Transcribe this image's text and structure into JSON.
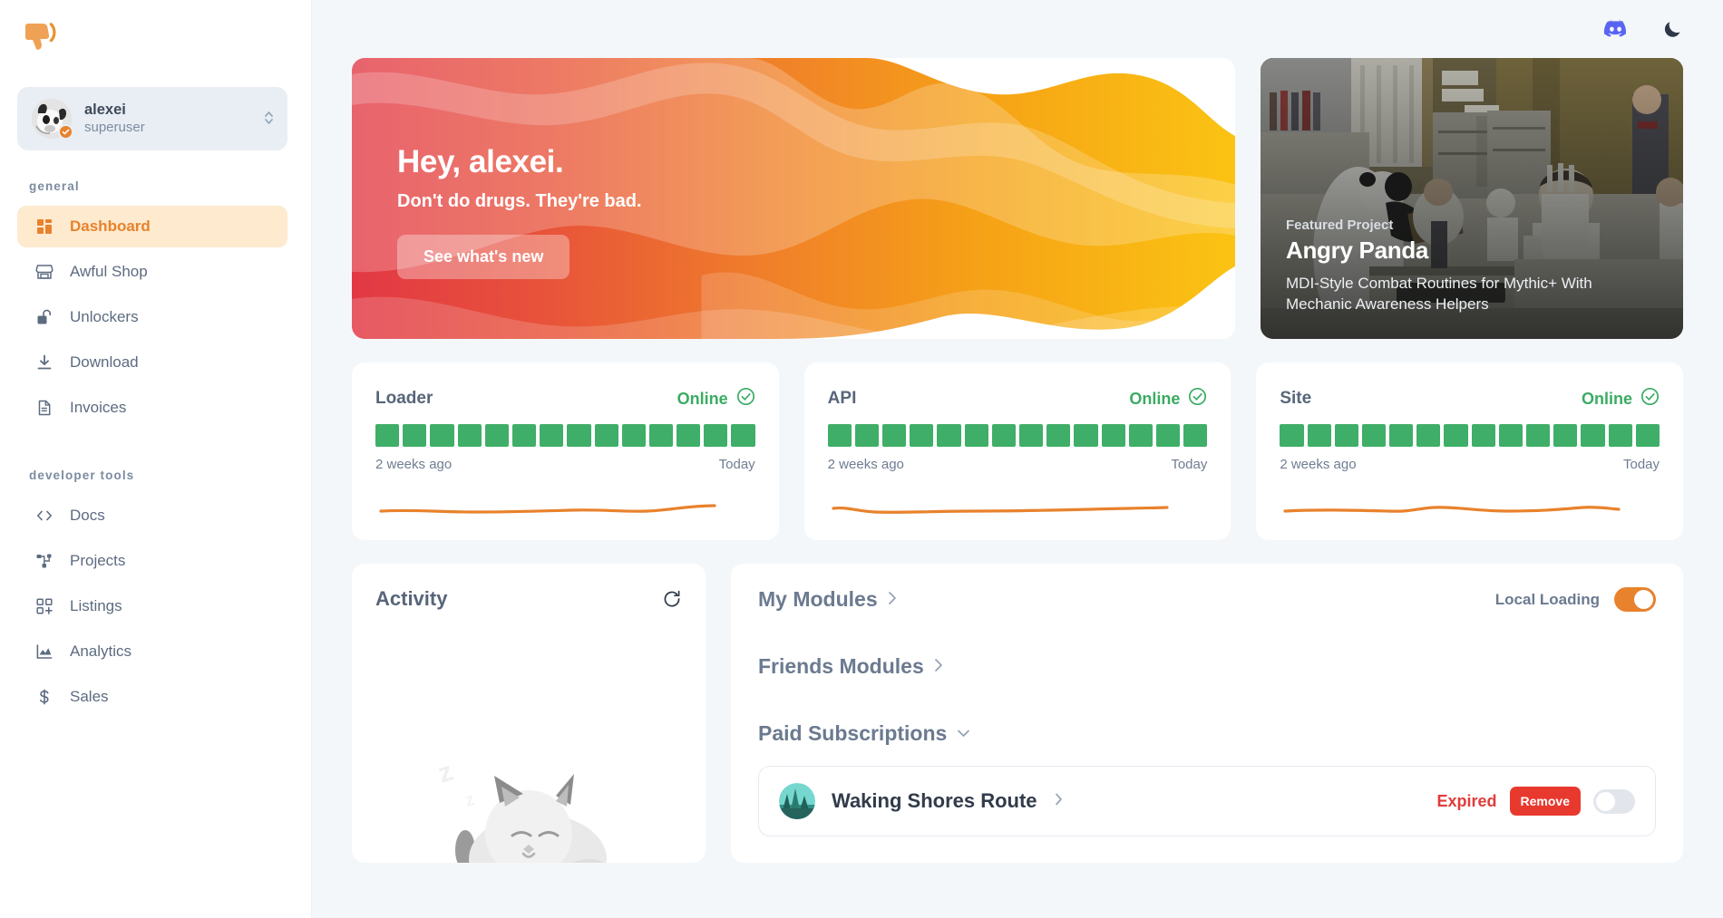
{
  "brand": {
    "logo_icon": "thumbs-down-icon",
    "accent": "#e8822c",
    "online_color": "#3bab63",
    "danger": "#e8392f"
  },
  "sidebar": {
    "user": {
      "name": "alexei",
      "role": "superuser",
      "verified_icon": "verified-check-icon",
      "selector_icon": "chevron-up-down-icon"
    },
    "sections": [
      {
        "label": "general",
        "items": [
          {
            "label": "Dashboard",
            "icon": "dashboard-grid-icon",
            "active": true
          },
          {
            "label": "Awful Shop",
            "icon": "store-icon",
            "active": false
          },
          {
            "label": "Unlockers",
            "icon": "unlock-icon",
            "active": false
          },
          {
            "label": "Download",
            "icon": "download-icon",
            "active": false
          },
          {
            "label": "Invoices",
            "icon": "document-icon",
            "active": false
          }
        ]
      },
      {
        "label": "developer tools",
        "items": [
          {
            "label": "Docs",
            "icon": "code-brackets-icon",
            "active": false
          },
          {
            "label": "Projects",
            "icon": "sitemap-icon",
            "active": false
          },
          {
            "label": "Listings",
            "icon": "grid-plus-icon",
            "active": false
          },
          {
            "label": "Analytics",
            "icon": "chart-area-icon",
            "active": false
          },
          {
            "label": "Sales",
            "icon": "dollar-icon",
            "active": false
          }
        ]
      }
    ]
  },
  "topbar": {
    "discord_icon": "discord-icon",
    "theme_icon": "moon-icon"
  },
  "hero": {
    "title": "Hey, alexei.",
    "subtitle": "Don't do drugs. They're bad.",
    "button": "See what's new",
    "gradient_from": "#e23845",
    "gradient_to": "#fbc313"
  },
  "featured": {
    "kicker": "Featured Project",
    "title": "Angry Panda",
    "description": "MDI-Style Combat Routines for Mythic+ With Mechanic Awareness Helpers"
  },
  "status_cards": [
    {
      "name": "Loader",
      "state": "Online",
      "state_icon": "check-circle-icon",
      "range_start": "2 weeks ago",
      "range_end": "Today",
      "bar_count": 14,
      "bar_color": "#3fae68"
    },
    {
      "name": "API",
      "state": "Online",
      "state_icon": "check-circle-icon",
      "range_start": "2 weeks ago",
      "range_end": "Today",
      "bar_count": 14,
      "bar_color": "#3fae68"
    },
    {
      "name": "Site",
      "state": "Online",
      "state_icon": "check-circle-icon",
      "range_start": "2 weeks ago",
      "range_end": "Today",
      "bar_count": 14,
      "bar_color": "#3fae68"
    }
  ],
  "activity": {
    "title": "Activity",
    "refresh_icon": "refresh-icon",
    "empty_art": "sleeping-cat-illustration"
  },
  "modules": {
    "my_modules": {
      "label": "My Modules",
      "icon": "chevron-right-icon"
    },
    "friends_modules": {
      "label": "Friends Modules",
      "icon": "chevron-right-icon"
    },
    "paid_subscriptions": {
      "label": "Paid Subscriptions",
      "icon": "chevron-down-icon"
    },
    "local_loading": {
      "label": "Local Loading",
      "enabled": true
    },
    "subscriptions": [
      {
        "name": "Waking Shores Route",
        "status": "Expired",
        "remove_label": "Remove",
        "chevron_icon": "chevron-right-icon",
        "toggle_enabled": false
      }
    ]
  }
}
